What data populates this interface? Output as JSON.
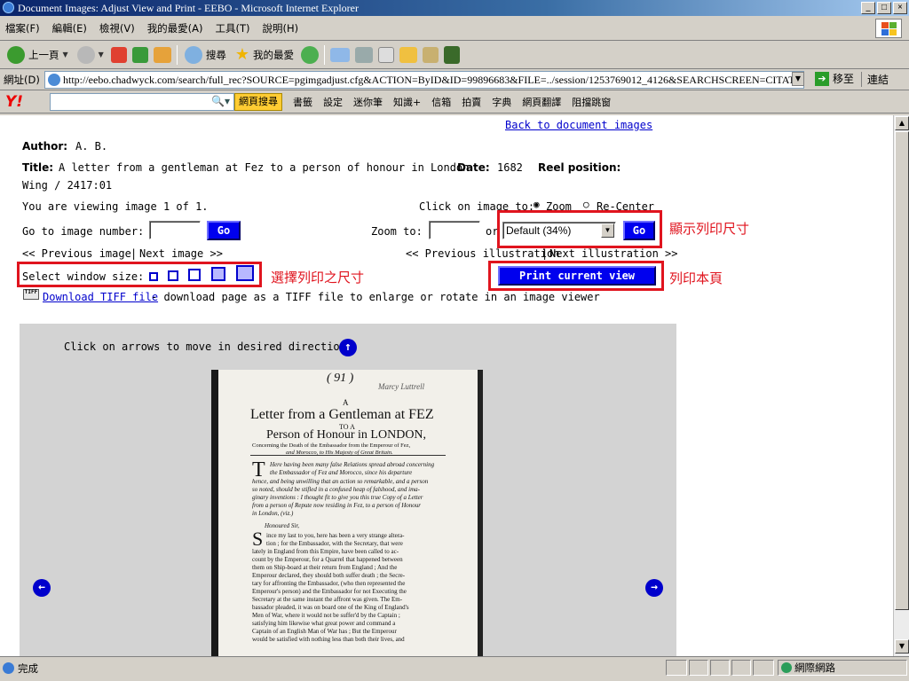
{
  "window": {
    "title": "Document Images: Adjust View and Print - EEBO - Microsoft Internet Explorer"
  },
  "menu": [
    "檔案(F)",
    "編輯(E)",
    "檢視(V)",
    "我的最愛(A)",
    "工具(T)",
    "說明(H)"
  ],
  "toolbar": {
    "back": "上一頁",
    "search": "搜尋",
    "favorites": "我的最愛"
  },
  "address": {
    "label": "網址(D)",
    "url": "http://eebo.chadwyck.com/search/full_rec?SOURCE=pgimgadjust.cfg&ACTION=ByID&ID=99896683&FILE=../session/1253769012_4126&SEARCHSCREEN=CITATIONS",
    "go": "移至",
    "links": "連結"
  },
  "yahoo": {
    "logo": "Y!",
    "search_button": "網頁搜尋",
    "items": [
      "書籤",
      "設定",
      "迷你筆",
      "知識+",
      "信箱",
      "拍賣",
      "字典",
      "網頁翻譯",
      "阻擋跳窗"
    ]
  },
  "record": {
    "back_link": "Back to document images",
    "author_label": "Author:",
    "author": "A. B.",
    "title_label": "Title:",
    "title": "A letter from a gentleman at Fez to a person of honour in London",
    "date_label": "Date:",
    "date": "1682",
    "reel_label": "Reel position:",
    "reel": "Wing / 2417:01",
    "viewing": "You are viewing image 1 of 1.",
    "click_on_image": "Click on image to:",
    "zoom_option": "Zoom",
    "recenter_option": "Re-Center",
    "goto_label": "Go to image number:",
    "go": "Go",
    "zoom_to": "Zoom to:",
    "or": "or",
    "zoom_select": "Default (34%)",
    "prev_image": "<< Previous image",
    "next_image": "Next image >>",
    "prev_illus": "<< Previous illustration",
    "next_illus": "Next illustration >>",
    "select_window_size": "Select window size:",
    "print_button": "Print current view",
    "download_link": "Download TIFF file",
    "download_text": " - download page as a TIFF file to enlarge or rotate in an image viewer",
    "arrows_text": "Click on arrows to move in desired direction"
  },
  "annotations": {
    "display_size": "顯示列印尺寸",
    "select_size": "選擇列印之尺寸",
    "print_page": "列印本頁"
  },
  "scan": {
    "page_no": "( 91 )",
    "marginalia": "Marcy Luttrell",
    "head_a": "A",
    "head_letter": "Letter from a Gentleman at FEZ",
    "head_toa": "TO A",
    "head_person": "Person of Honour in LONDON,",
    "subtitle1": "Concerning the Death of the Embassador from the Emperour of Fez,",
    "subtitle2": "and Morocco, to His Majesty of Great Britain.",
    "para1": [
      "Here having been many false Relations spread abroad concerning",
      "the Embassador of Fez and Morocco, since his departure",
      "hence, and being unwilling that an action so remarkable, and a person",
      "so noted, should be stifled in a confused heap of falshood, and ima-",
      "ginary inventions : I thought fit to give you this true Copy of a Letter",
      "from a person of Repute now residing in Fez, to a person of Honour",
      "in London, (viz.)"
    ],
    "honoured": "Honoured Sir,",
    "para2": [
      "ince my last to you, here has been a very strange altera-",
      "tion ; for the Embassador, with the Secretary, that were",
      "lately in England from this Empire, have been called to ac-",
      "count by the Emperour, for a Quarrel that happened between",
      "them on Ship-board at their return from England ; And the",
      "Emperour declared, they should both suffer death ; the Secre-",
      "tary for affronting the Embassador, (who then represented the",
      "Emperour's person) and the Embassador for not Executing the",
      "Secretary at the same instant the affront was given. The Em-",
      "bassador pleaded, it was on board one of the King of England's",
      "Men of War, where it would not be suffer'd by the Captain ;",
      "satisfying him likewise what great power and command a",
      "Captain of an English Man of War has ; But the Emperour",
      "would be satisfied with nothing less than both their lives, and"
    ]
  },
  "status": {
    "text": "完成",
    "zone": "網際網路"
  }
}
